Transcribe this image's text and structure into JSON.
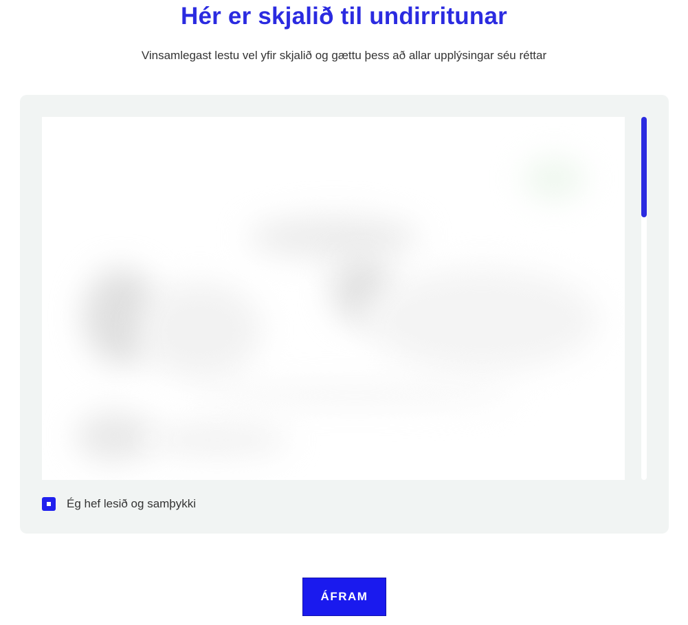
{
  "header": {
    "title": "Hér er skjalið til undirritunar",
    "subtitle": "Vinsamlegast lestu vel yfir skjalið og gættu þess að allar upplýsingar séu réttar"
  },
  "agreement": {
    "checkbox_label": "Ég hef lesið og samþykki",
    "checked": true
  },
  "actions": {
    "continue_label": "ÁFRAM"
  },
  "colors": {
    "accent": "#2b2be0",
    "button": "#1a1aee",
    "panel_bg": "#f1f4f3"
  }
}
